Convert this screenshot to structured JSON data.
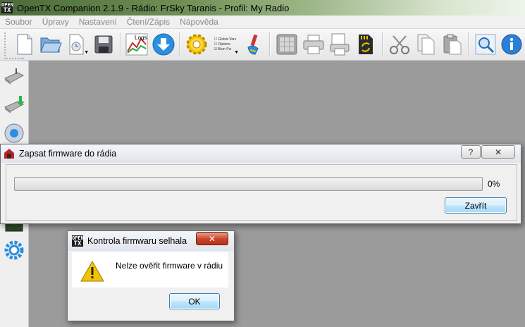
{
  "window": {
    "title": "OpenTX Companion 2.1.9 - Rádio: FrSky Taranis - Profil: My Radio",
    "logo_top": "OPEN",
    "logo_bottom": "TX"
  },
  "menu": [
    "Soubor",
    "Úpravy",
    "Nastavení",
    "Čtení/Zápis",
    "Nápověda"
  ],
  "toolbar": {
    "logs_label": "Logs",
    "checklist": [
      "Global Vars",
      "Options",
      "Burn Fw"
    ]
  },
  "colors": {
    "accent_blue": "#2a8fe0",
    "warning_yellow": "#f3c300",
    "close_red": "#c9432b",
    "progress_green": "#3fb34f"
  },
  "icons": {
    "main_toolbar": [
      "new-file-icon",
      "open-folder-icon",
      "recent-file-icon",
      "save-icon",
      "logs-chart-icon",
      "download-icon",
      "settings-gear-icon",
      "checklist-icon",
      "customize-brush-icon",
      "calculator-icon",
      "print-icon",
      "print-preview-icon",
      "sd-card-sync-icon",
      "cut-scissors-icon",
      "copy-icon",
      "paste-icon",
      "search-icon",
      "info-icon"
    ],
    "side_toolbar": [
      "read-models-icon",
      "write-models-icon",
      "firmware-icon",
      "write-firmware-icon",
      "radio-settings-icon"
    ]
  },
  "burn_dialog": {
    "title": "Zapsat firmware do rádia",
    "help_button": "?",
    "close_button": "✕",
    "progress_percent": 0,
    "progress_text": "0%",
    "close_label": "Zavřít"
  },
  "fail_dialog": {
    "title": "Kontrola firmwaru selhala",
    "message": "Nelze ověřit firmware v rádiu",
    "ok_label": "OK",
    "close_button": "✕"
  }
}
